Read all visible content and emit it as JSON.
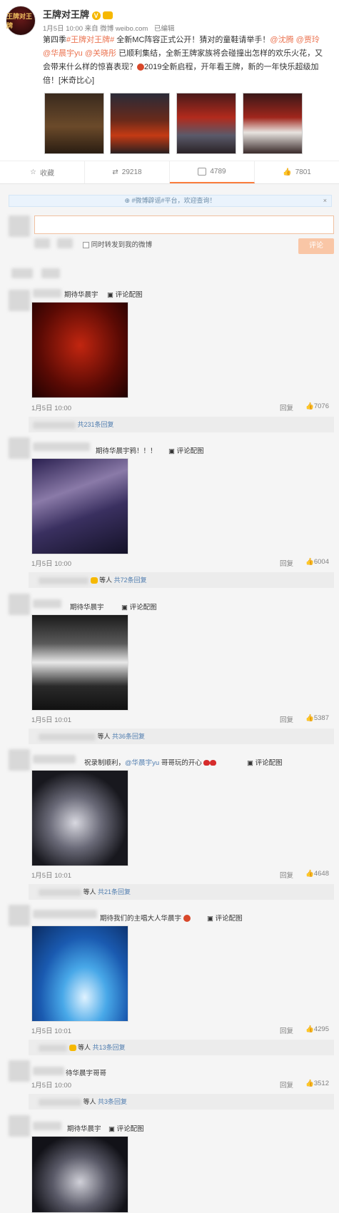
{
  "post": {
    "author": "王牌对王牌",
    "avatar_text": "王牌对王牌",
    "time": "1月5日 10:00",
    "source": "来自 微博 weibo.com",
    "edited": "已编辑",
    "text_1": "第四季",
    "tag_1": "#王牌对王牌#",
    "text_2": " 全新MC阵容正式公开！猜对的童鞋请举手！",
    "mention_1": "@沈腾",
    "mention_2": "@贾玲",
    "mention_3": "@华晨宇yu",
    "mention_4": "@关晓彤",
    "text_3": " 已顺利集结，全新王牌家族将会碰撞出怎样的欢乐火花，又",
    "text_4": "会带来什么样的惊喜表现？",
    "text_5": "2019全新启程，开年看王牌，新的一年快乐超级加",
    "text_6": "倍！[米奇比心]"
  },
  "actions": {
    "fav": "收藏",
    "repost": "29218",
    "comment": "4789",
    "like": "7801"
  },
  "panel": {
    "notice": "#微博辟谣#平台，欢迎查询！",
    "repost_check": "同时转发到我的微博",
    "submit": "评论"
  },
  "comments": [
    {
      "text": "期待华晨宇",
      "pic": "评论配图",
      "time": "1月5日 10:00",
      "reply": "回复",
      "likes": "7076",
      "sub": "共231条回复",
      "sub_prefix": ""
    },
    {
      "text": "期待华晨宇鸦！！！",
      "pic": "评论配图",
      "time": "1月5日 10:00",
      "reply": "回复",
      "likes": "6004",
      "sub": "共72条回复",
      "sub_prefix": "等人"
    },
    {
      "text": "期待华晨宇",
      "pic": "评论配图",
      "time": "1月5日 10:01",
      "reply": "回复",
      "likes": "5387",
      "sub": "共36条回复",
      "sub_prefix": "等人"
    },
    {
      "text_a": "祝录制顺利，",
      "mention": "@华晨宇yu",
      "text_b": " 哥哥玩的开心",
      "pic": "评论配图",
      "time": "1月5日 10:01",
      "reply": "回复",
      "likes": "4648",
      "sub": "共21条回复",
      "sub_prefix": "等人"
    },
    {
      "text": "期待我们的主唱大人华晨宇",
      "pic": "评论配图",
      "time": "1月5日 10:01",
      "reply": "回复",
      "likes": "4295",
      "sub": "共13条回复",
      "sub_prefix": "等人"
    },
    {
      "text": "待华晨宇哥哥",
      "time": "1月5日 10:00",
      "reply": "回复",
      "likes": "3512",
      "sub": "共3条回复",
      "sub_prefix": "等人"
    },
    {
      "text": "期待华晨宇",
      "pic": "评论配图"
    }
  ],
  "colors": {
    "link": "#eb7350",
    "blue": "#507daf",
    "badge": "#f6b800"
  }
}
